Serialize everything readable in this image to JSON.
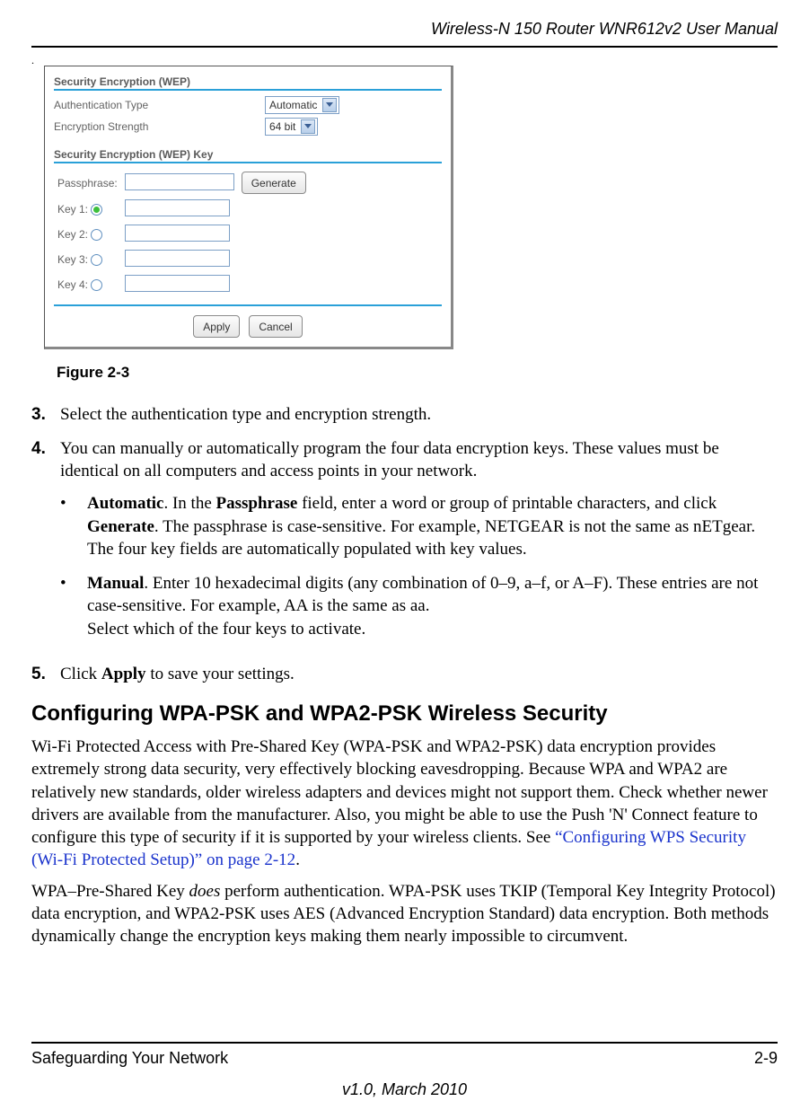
{
  "running_head": "Wireless-N 150 Router WNR612v2 User Manual",
  "screenshot": {
    "section1_title": "Security Encryption (WEP)",
    "auth_label": "Authentication Type",
    "auth_value": "Automatic",
    "enc_label": "Encryption Strength",
    "enc_value": "64 bit",
    "section2_title": "Security Encryption (WEP) Key",
    "passphrase_label": "Passphrase:",
    "generate_btn": "Generate",
    "key1": "Key 1:",
    "key2": "Key 2:",
    "key3": "Key 3:",
    "key4": "Key 4:",
    "apply_btn": "Apply",
    "cancel_btn": "Cancel"
  },
  "figure_label": "Figure 2-3",
  "steps": {
    "s3_num": "3.",
    "s3": "Select the authentication type and encryption strength.",
    "s4_num": "4.",
    "s4": "You can manually or automatically program the four data encryption keys. These values must be identical on all computers and access points in your network.",
    "b1_lead": "Automatic",
    "b1_mid": ". In the ",
    "b1_field": "Passphrase",
    "b1_after": " field, enter a word or group of printable characters, and click ",
    "b1_gen": "Generate",
    "b1_tail": ". The passphrase is case-sensitive. For example, NETGEAR is not the same as nETgear. The four key fields are automatically populated with key values.",
    "b2_lead": "Manual",
    "b2_body": ". Enter 10 hexadecimal digits (any combination of 0–9, a–f, or A–F). These entries are not case-sensitive. For example, AA is the same as aa.",
    "b2_line2": "Select which of the four keys to activate.",
    "s5_num": "5.",
    "s5_pre": "Click ",
    "s5_bold": "Apply",
    "s5_post": " to save your settings."
  },
  "heading": "Configuring WPA-PSK and WPA2-PSK Wireless Security",
  "p1_a": "Wi-Fi Protected Access with Pre-Shared Key (WPA-PSK and WPA2-PSK) data encryption provides extremely strong data security, very effectively blocking eavesdropping. Because WPA and WPA2 are relatively new standards, older wireless adapters and devices might not support them. Check whether newer drivers are available from the manufacturer. Also, you might be able to use the Push 'N' Connect feature to configure this type of security if it is supported by your wireless clients. See ",
  "p1_link": "“Configuring WPS Security (Wi-Fi Protected Setup)” on page 2-12",
  "p1_b": ".",
  "p2_a": "WPA–Pre-Shared Key ",
  "p2_ital": "does",
  "p2_b": " perform authentication. WPA-PSK uses TKIP (Temporal Key Integrity Protocol) data encryption, and WPA2-PSK uses AES (Advanced Encryption Standard) data encryption. Both methods dynamically change the encryption keys making them nearly impossible to circumvent.",
  "footer": {
    "left": "Safeguarding Your Network",
    "right": "2-9",
    "version": "v1.0, March 2010"
  }
}
